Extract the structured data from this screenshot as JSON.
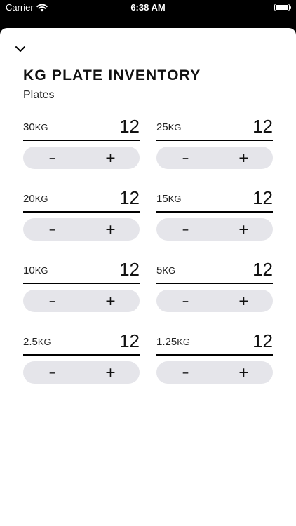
{
  "status_bar": {
    "carrier": "Carrier",
    "time": "6:38 AM"
  },
  "header": {
    "title": "KG PLATE INVENTORY",
    "subtitle": "Plates"
  },
  "stepper": {
    "decrement_label": "–",
    "increment_label": "+"
  },
  "plates": [
    {
      "weight": "30",
      "unit": "KG",
      "count": "12"
    },
    {
      "weight": "25",
      "unit": "KG",
      "count": "12"
    },
    {
      "weight": "20",
      "unit": "KG",
      "count": "12"
    },
    {
      "weight": "15",
      "unit": "KG",
      "count": "12"
    },
    {
      "weight": "10",
      "unit": "KG",
      "count": "12"
    },
    {
      "weight": "5",
      "unit": "KG",
      "count": "12"
    },
    {
      "weight": "2.5",
      "unit": "KG",
      "count": "12"
    },
    {
      "weight": "1.25",
      "unit": "KG",
      "count": "12"
    }
  ]
}
